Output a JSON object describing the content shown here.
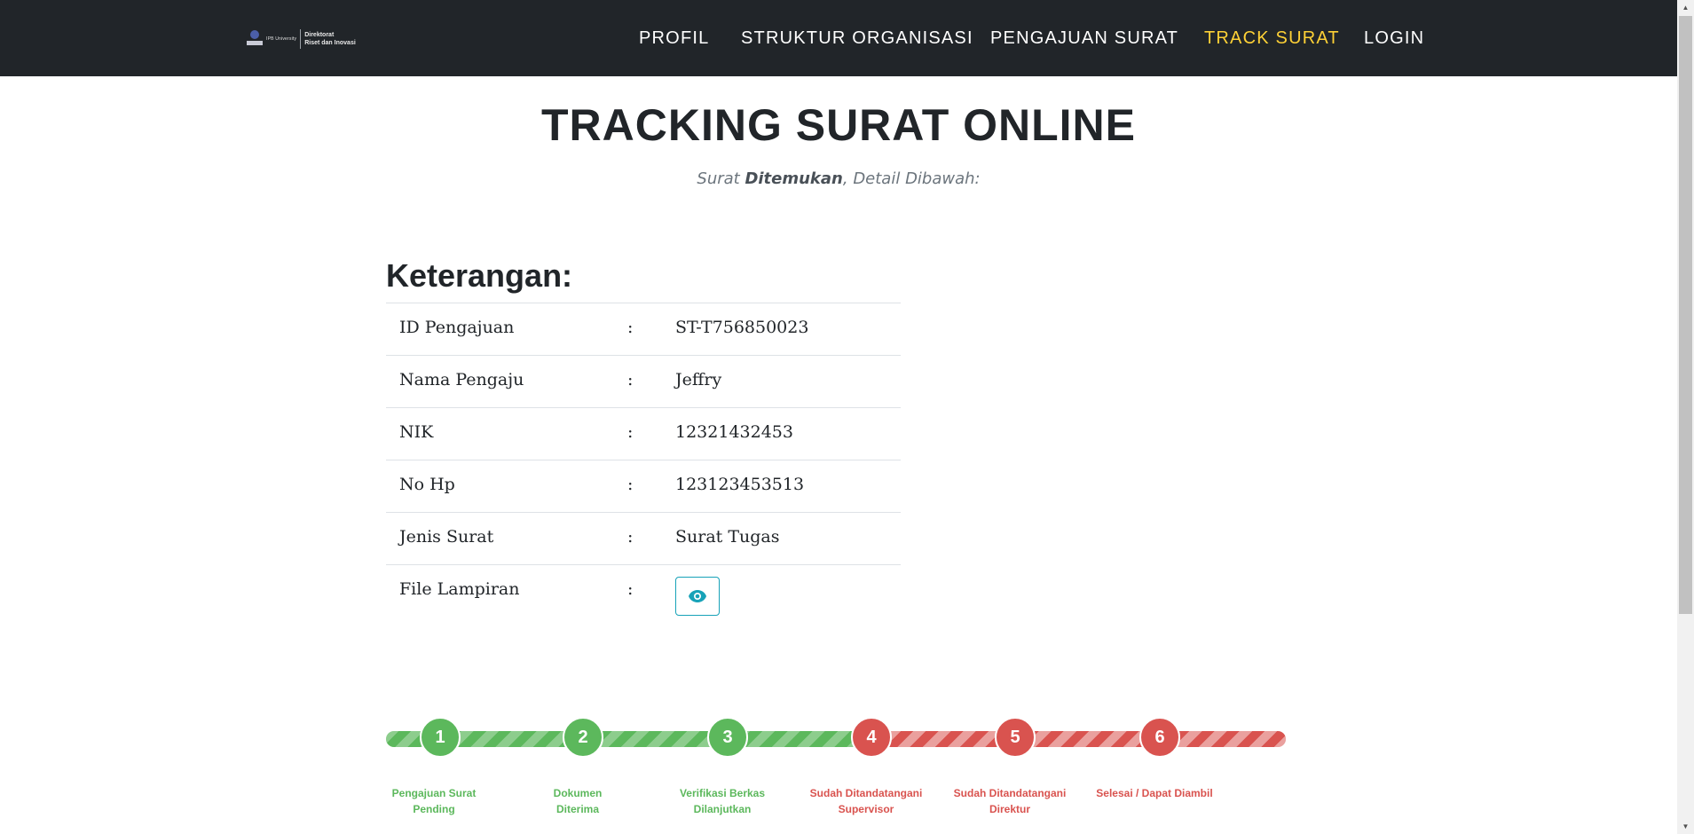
{
  "header": {
    "logo_university": "IPB University",
    "logo_line1": "Direktorat",
    "logo_line2": "Riset dan Inovasi",
    "nav": [
      {
        "label": "PROFIL",
        "active": false
      },
      {
        "label": "STRUKTUR ORGANISASI",
        "active": false
      },
      {
        "label": "PENGAJUAN SURAT",
        "active": false
      },
      {
        "label": "TRACK SURAT",
        "active": true
      },
      {
        "label": "LOGIN",
        "active": false
      }
    ]
  },
  "page": {
    "title": "TRACKING SURAT ONLINE",
    "subtitle_prefix": "Surat ",
    "subtitle_bold": "Ditemukan",
    "subtitle_suffix": ", Detail Dibawah:"
  },
  "details": {
    "heading": "Keterangan:",
    "separator": ":",
    "rows": [
      {
        "label": "ID Pengajuan",
        "value": "ST-T756850023"
      },
      {
        "label": "Nama Pengaju",
        "value": "Jeffry"
      },
      {
        "label": "NIK",
        "value": "12321432453"
      },
      {
        "label": "No Hp",
        "value": "123123453513"
      },
      {
        "label": "Jenis Surat",
        "value": "Surat Tugas"
      },
      {
        "label": "File Lampiran",
        "value": ""
      }
    ],
    "attachment_icon": "eye-icon"
  },
  "progress": {
    "completed_steps": 3,
    "total_steps": 6,
    "steps": [
      {
        "number": "1",
        "line1": "Pengajuan Surat",
        "line2": "Pending",
        "status": "done"
      },
      {
        "number": "2",
        "line1": "Dokumen",
        "line2": "Diterima",
        "status": "done"
      },
      {
        "number": "3",
        "line1": "Verifikasi Berkas",
        "line2": "Dilanjutkan",
        "status": "done"
      },
      {
        "number": "4",
        "line1": "Sudah Ditandatangani",
        "line2": "Supervisor",
        "status": "todo"
      },
      {
        "number": "5",
        "line1": "Sudah Ditandatangani",
        "line2": "Direktur",
        "status": "todo"
      },
      {
        "number": "6",
        "line1": "Selesai / Dapat Diambil",
        "line2": "",
        "status": "todo"
      }
    ]
  },
  "colors": {
    "header_bg": "#212529",
    "active_nav": "#fed136",
    "done": "#5cb85c",
    "todo": "#d9534f",
    "attachment_button": "#17a2b8"
  }
}
